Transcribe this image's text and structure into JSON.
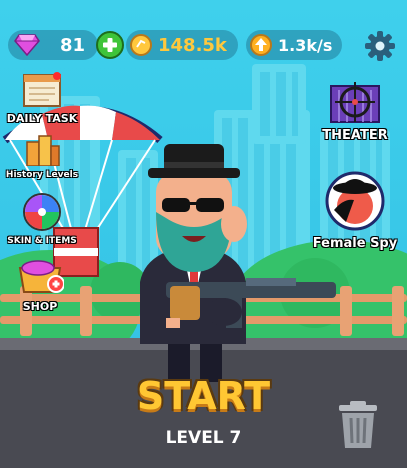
{
  "currency": {
    "gems": "81",
    "coins": "148.5k",
    "coin_rate": "1.3k/s"
  },
  "side_menu": {
    "daily_task": "DAILY TASK",
    "history_levels": "History Levels",
    "skin_items": "SKIN & ITEMS",
    "shop": "SHOP",
    "theater": "THEATER",
    "female_spy": "Female Spy"
  },
  "main": {
    "start_label": "START",
    "level_label": "LEVEL 7"
  },
  "colors": {
    "sky": "#37c7e7",
    "start_text": "#ffc733",
    "coin_text": "#ffc83d",
    "gem": "#e04fe0",
    "plus_button": "#3ec43a"
  },
  "icons": [
    "gem-icon",
    "plus-icon",
    "coin-icon",
    "arrow-up-icon",
    "gear-icon",
    "trash-icon"
  ]
}
